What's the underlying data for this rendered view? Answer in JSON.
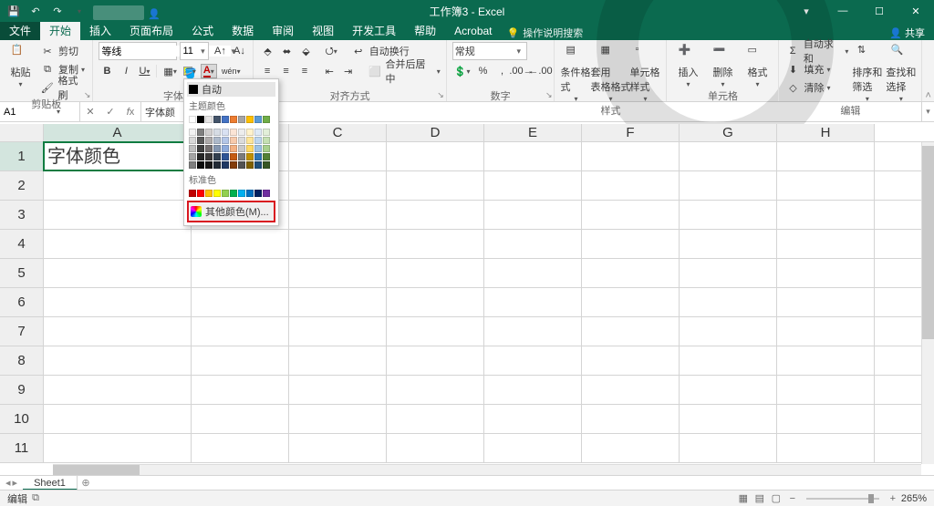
{
  "app": {
    "title": "工作簿3 - Excel"
  },
  "qat": {
    "save": "💾",
    "undo": "↶",
    "redo": "↷"
  },
  "win": {
    "min": "—",
    "max": "☐",
    "close": "✕",
    "ribbon_opts": "▾"
  },
  "tabs": {
    "file": "文件",
    "home": "开始",
    "insert": "插入",
    "layout": "页面布局",
    "formulas": "公式",
    "data": "数据",
    "review": "审阅",
    "view": "视图",
    "dev": "开发工具",
    "help": "帮助",
    "acrobat": "Acrobat",
    "tell": "操作说明搜索",
    "share": "共享"
  },
  "ribbon": {
    "clipboard": {
      "paste": "粘贴",
      "cut": "剪切",
      "copy": "复制",
      "format_painter": "格式刷",
      "label": "剪贴板"
    },
    "font": {
      "name": "等线",
      "size": "11",
      "bold": "B",
      "italic": "I",
      "underline": "U",
      "label": "字体"
    },
    "align": {
      "wrap": "自动换行",
      "merge": "合并后居中",
      "label": "对齐方式"
    },
    "number": {
      "format": "常规",
      "label": "数字"
    },
    "styles": {
      "cond": "条件格式",
      "table": "套用\n表格格式",
      "cell": "单元格样式",
      "label": "样式"
    },
    "cells": {
      "insert": "插入",
      "delete": "删除",
      "format": "格式",
      "label": "单元格"
    },
    "editing": {
      "sum": "自动求和",
      "fill": "填充",
      "clear": "清除",
      "sort": "排序和筛选",
      "find": "查找和选择",
      "label": "编辑"
    }
  },
  "fx": {
    "cellref": "A1",
    "formula": "字体颜"
  },
  "grid": {
    "cols": [
      "A",
      "B",
      "C",
      "D",
      "E",
      "F",
      "G",
      "H"
    ],
    "rows": [
      1,
      2,
      3,
      4,
      5,
      6,
      7,
      8,
      9,
      10,
      11
    ],
    "cell_A1": "字体颜色"
  },
  "colorpicker": {
    "auto": "自动",
    "theme": "主题颜色",
    "standard": "标准色",
    "more": "其他颜色(M)...",
    "theme_row1": [
      "#ffffff",
      "#000000",
      "#e7e6e6",
      "#44546a",
      "#4472c4",
      "#ed7d31",
      "#a5a5a5",
      "#ffc000",
      "#5b9bd5",
      "#70ad47"
    ],
    "theme_shades": [
      [
        "#f2f2f2",
        "#7f7f7f",
        "#d0cece",
        "#d6dce4",
        "#d9e1f2",
        "#fbe4d5",
        "#ededed",
        "#fff2cc",
        "#deeaf6",
        "#e2efd9"
      ],
      [
        "#d8d8d8",
        "#595959",
        "#aeabab",
        "#adb9ca",
        "#b4c6e7",
        "#f7caac",
        "#dbdbdb",
        "#fee599",
        "#bdd6ee",
        "#c5e0b3"
      ],
      [
        "#bfbfbf",
        "#3f3f3f",
        "#757070",
        "#8496b0",
        "#8eaadb",
        "#f4b183",
        "#c9c9c9",
        "#ffd965",
        "#9cc2e5",
        "#a8d08d"
      ],
      [
        "#a5a5a5",
        "#262626",
        "#3a3838",
        "#323f4f",
        "#2f5496",
        "#c55a11",
        "#7b7b7b",
        "#bf9000",
        "#2e75b5",
        "#538135"
      ],
      [
        "#7f7f7f",
        "#0c0c0c",
        "#171616",
        "#222a35",
        "#1f3864",
        "#833c0b",
        "#525252",
        "#7f6000",
        "#1e4e79",
        "#375623"
      ]
    ],
    "standard_row": [
      "#c00000",
      "#ff0000",
      "#ffc000",
      "#ffff00",
      "#92d050",
      "#00b050",
      "#00b0f0",
      "#0070c0",
      "#002060",
      "#7030a0"
    ]
  },
  "sheets": {
    "sheet1": "Sheet1",
    "new": "⊕"
  },
  "status": {
    "mode": "编辑",
    "acc": "⧉",
    "views": [
      "▦",
      "▤",
      "▢"
    ],
    "zoom_minus": "−",
    "zoom_plus": "+",
    "zoom": "265%"
  }
}
